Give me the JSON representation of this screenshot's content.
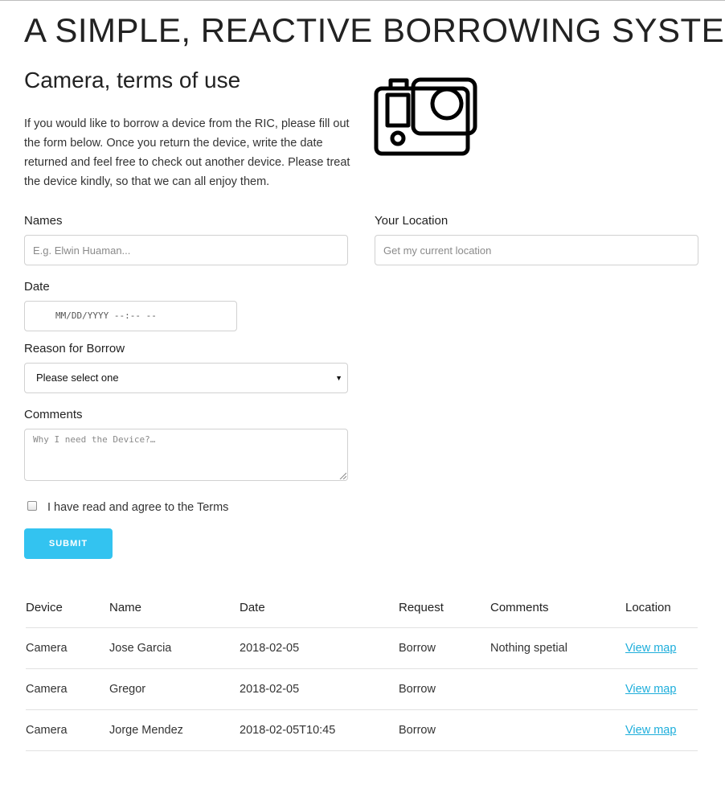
{
  "app": {
    "title": "A SIMPLE, REACTIVE BORROWING SYSTEM"
  },
  "device_section": {
    "title": "Camera, terms of use",
    "intro": "If you would like to borrow a device from the RIC, please fill out the form below. Once you return the device, write the date returned and feel free to check out another device. Please treat the device kindly, so that we can all enjoy them.",
    "image_icon": "action-camera-icon"
  },
  "form": {
    "names": {
      "label": "Names",
      "placeholder": "E.g. Elwin Huaman..."
    },
    "location": {
      "label": "Your Location",
      "placeholder": "Get my current location"
    },
    "date": {
      "label": "Date",
      "placeholder": "MM/DD/YYYY --:-- --"
    },
    "reason": {
      "label": "Reason for Borrow",
      "selected": "Please select one"
    },
    "comments": {
      "label": "Comments",
      "placeholder": "Why I need the Device?…"
    },
    "terms": {
      "label": "I have read and agree to the Terms",
      "checked": false
    },
    "submit_label": "Submit",
    "accent_color": "#33c3f0"
  },
  "table": {
    "headers": {
      "device": "Device",
      "name": "Name",
      "date": "Date",
      "request": "Request",
      "comments": "Comments",
      "location": "Location"
    },
    "rows": [
      {
        "device": "Camera",
        "name": "Jose Garcia",
        "date": "2018-02-05",
        "request": "Borrow",
        "comments": "Nothing spetial",
        "location": "View map"
      },
      {
        "device": "Camera",
        "name": "Gregor",
        "date": "2018-02-05",
        "request": "Borrow",
        "comments": "",
        "location": "View map"
      },
      {
        "device": "Camera",
        "name": "Jorge Mendez",
        "date": "2018-02-05T10:45",
        "request": "Borrow",
        "comments": "",
        "location": "View map"
      }
    ],
    "link_color": "#1eaedb"
  }
}
